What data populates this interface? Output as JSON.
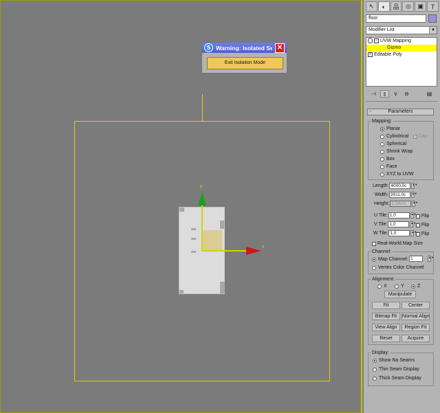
{
  "viewport": {
    "axis_x_label": "x",
    "axis_y_label": "y"
  },
  "warning_dialog": {
    "title": "Warning: Isolated Sel...",
    "logo_glyph": "S",
    "close_glyph": "✕",
    "exit_button": "Exit Isolation Mode"
  },
  "command_panel": {
    "tabs": [
      {
        "icon": "create-icon",
        "glyph": "↖"
      },
      {
        "icon": "modify-icon",
        "glyph": "◐"
      },
      {
        "icon": "hierarchy-icon",
        "glyph": "品"
      },
      {
        "icon": "motion-icon",
        "glyph": "◎"
      },
      {
        "icon": "display-icon",
        "glyph": "▣"
      },
      {
        "icon": "utilities-icon",
        "glyph": "T"
      }
    ],
    "object_name": "floor",
    "object_color": "#a18ce0",
    "modifier_list": "Modifier List",
    "modifier_list_arrow": "▼",
    "stack": [
      {
        "label": "UVW Mapping",
        "expand": "−"
      },
      {
        "label": "Gizmo"
      },
      {
        "label": "Editable Poly",
        "expand": "+"
      }
    ],
    "stack_tools": [
      {
        "icon": "pin-stack-icon",
        "glyph": "⊣"
      },
      {
        "icon": "show-end-result-icon",
        "glyph": "‖"
      },
      {
        "icon": "make-unique-icon",
        "glyph": "∨"
      },
      {
        "icon": "remove-modifier-icon",
        "glyph": "⊖"
      },
      {
        "icon": "configure-sets-icon",
        "glyph": "▤"
      }
    ]
  },
  "parameters": {
    "header": "Parameters",
    "collapse_glyph": "-",
    "mapping": {
      "title": "Mapping:",
      "options": [
        "Planar",
        "Cylindrical",
        "Spherical",
        "Shrink Wrap",
        "Box",
        "Face",
        "XYZ to UVW"
      ],
      "selected": "Planar",
      "cap_label": "Cap"
    },
    "length": {
      "label": "Length:",
      "value": "4000,0c"
    },
    "width": {
      "label": "Width:",
      "value": "3911,0c"
    },
    "height": {
      "label": "Height:",
      "value": "2,54cm"
    },
    "u_tile": {
      "label": "U Tile:",
      "value": "1,0"
    },
    "v_tile": {
      "label": "V Tile:",
      "value": "1,0"
    },
    "w_tile": {
      "label": "W Tile:",
      "value": "1,0"
    },
    "flip_label": "Flip",
    "real_world": "Real-World Map Size",
    "spin_glyph": "▲▼",
    "channel": {
      "title": "Channel:",
      "map_channel": "Map Channel:",
      "map_channel_value": "1",
      "vertex_color": "Vertex Color Channel"
    },
    "alignment": {
      "title": "Alignment:",
      "axes": [
        "X",
        "Y",
        "Z"
      ],
      "selected_axis": "Z",
      "manipulate": "Manipulate",
      "fit": "Fit",
      "center": "Center",
      "bitmap_fit": "Bitmap Fit",
      "normal_align": "Normal Align",
      "view_align": "View Align",
      "region_fit": "Region Fit",
      "reset": "Reset",
      "acquire": "Acquire"
    },
    "display": {
      "title": "Display:",
      "options": [
        "Show No Seams",
        "Thin Seam Display",
        "Thick Seam Display"
      ],
      "selected": "Show No Seams"
    }
  }
}
